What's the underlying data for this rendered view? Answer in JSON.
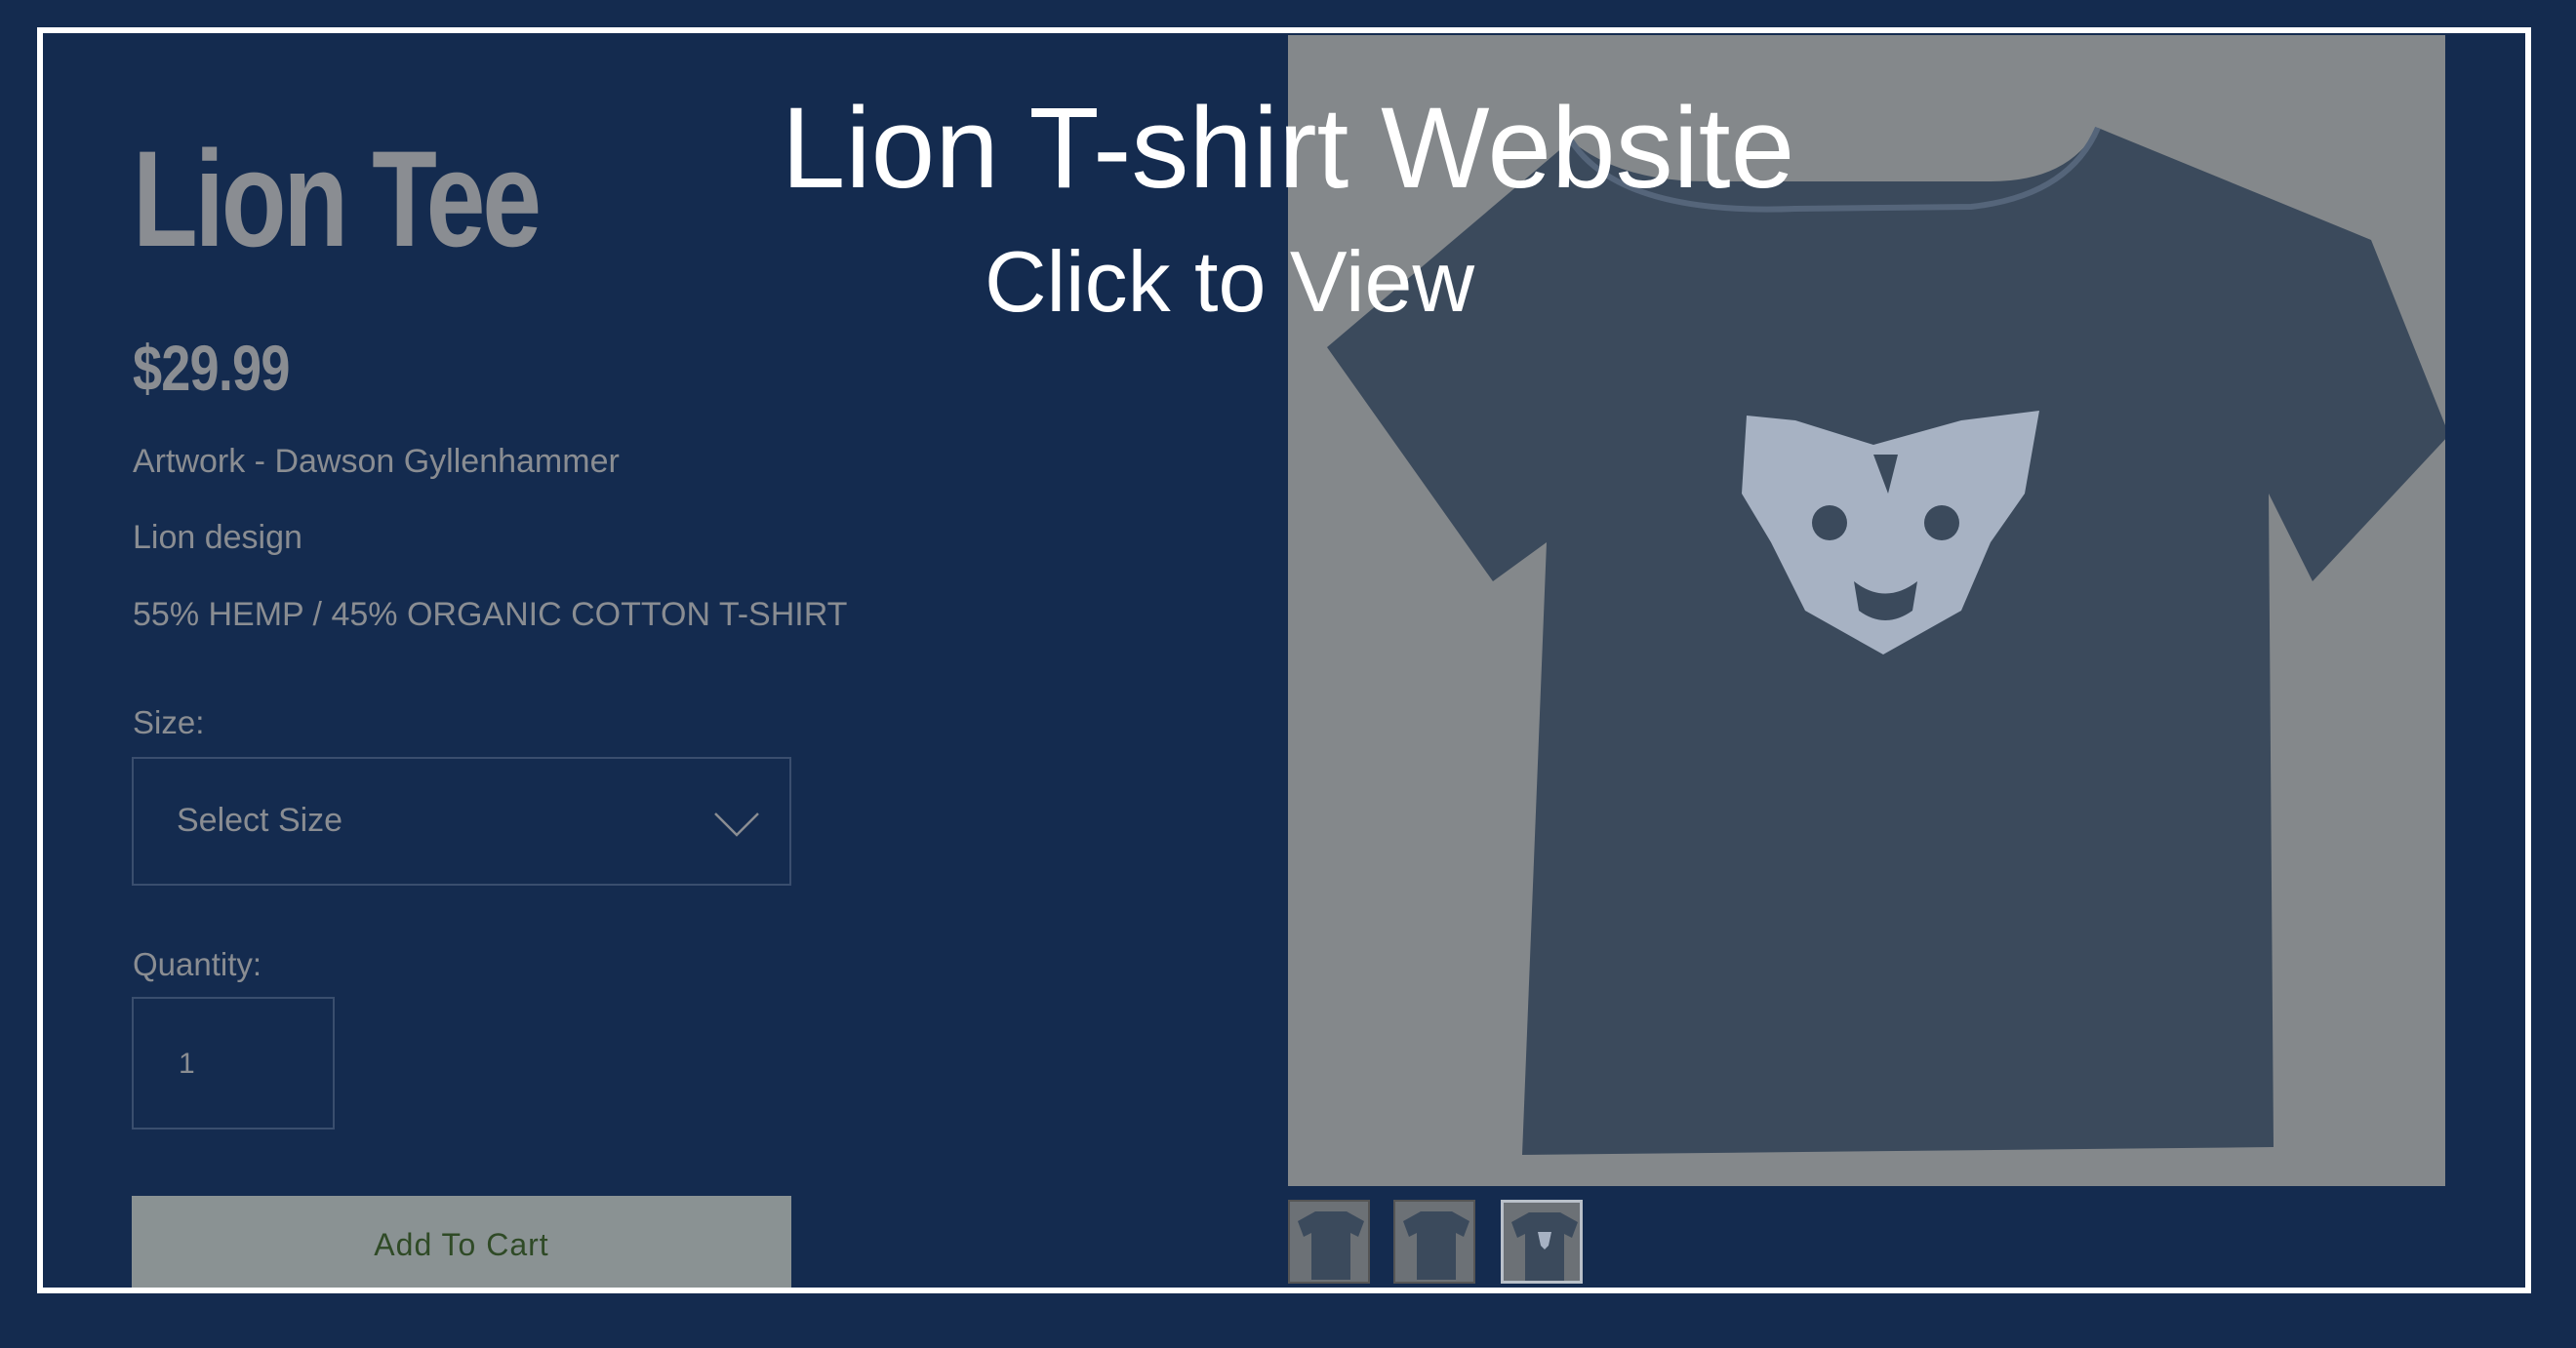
{
  "overlay": {
    "title": "Lion T-shirt Website",
    "subtitle": "Click to View"
  },
  "product": {
    "name": "Lion Tee",
    "price": "$29.99",
    "description_lines": [
      "Artwork - Dawson Gyllenhammer",
      "Lion design",
      "55% HEMP / 45% ORGANIC COTTON T-SHIRT"
    ],
    "size_label": "Size:",
    "size_select_value": "Select Size",
    "quantity_label": "Quantity:",
    "quantity_value": "1",
    "add_to_cart_label": "Add To Cart"
  },
  "gallery": {
    "thumbnail_count": 3,
    "selected_thumbnail": 3
  },
  "colors": {
    "background": "#142b4f",
    "frame": "#ffffff",
    "muted_text": "#8a8d92",
    "button": "#8a9293",
    "button_text": "#2f4a26"
  }
}
